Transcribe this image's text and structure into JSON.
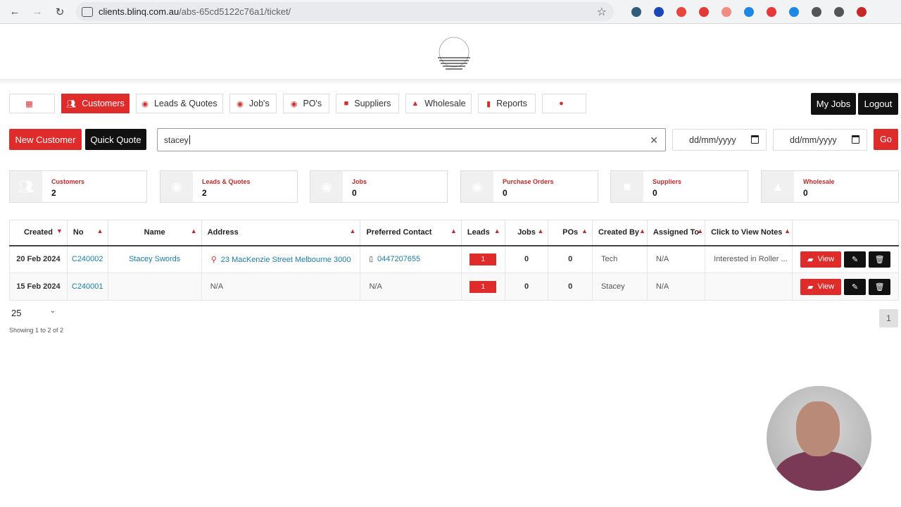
{
  "browser": {
    "url_host": "clients.blinq.com.au",
    "url_path": "/abs-65cd5122c76a1/ticket/",
    "extension_colors": [
      "#2f5d7c",
      "#1a47b8",
      "#e8453c",
      "#e53935",
      "#f28b82",
      "#1e88e5",
      "#e53935",
      "#1e88e5",
      "#555",
      "#555",
      "#c62828"
    ]
  },
  "nav": {
    "items": [
      {
        "icon": "calendar-icon",
        "label": ""
      },
      {
        "icon": "users-icon",
        "label": "Customers",
        "active": true
      },
      {
        "icon": "gauge-icon",
        "label": "Leads & Quotes"
      },
      {
        "icon": "gauge-icon",
        "label": "Job's"
      },
      {
        "icon": "gauge-icon",
        "label": "PO's"
      },
      {
        "icon": "truck-icon",
        "label": "Suppliers"
      },
      {
        "icon": "bag-icon",
        "label": "Wholesale"
      },
      {
        "icon": "chart-icon",
        "label": "Reports"
      },
      {
        "icon": "map-pin-icon",
        "label": ""
      }
    ],
    "my_jobs": "My Jobs",
    "logout": "Logout"
  },
  "actions": {
    "new_customer": "New Customer",
    "quick_quote": "Quick Quote",
    "search_value": "stacey",
    "date_from_placeholder": "dd/mm/yyyy",
    "date_to_placeholder": "dd/mm/yyyy",
    "go": "Go"
  },
  "cards": [
    {
      "label": "Customers",
      "count": "2",
      "icon": "users-icon"
    },
    {
      "label": "Leads & Quotes",
      "count": "2",
      "icon": "gauge-icon"
    },
    {
      "label": "Jobs",
      "count": "0",
      "icon": "gauge-icon"
    },
    {
      "label": "Purchase Orders",
      "count": "0",
      "icon": "gauge-icon"
    },
    {
      "label": "Suppliers",
      "count": "0",
      "icon": "truck-icon"
    },
    {
      "label": "Wholesale",
      "count": "0",
      "icon": "bag-icon"
    }
  ],
  "table": {
    "headers": [
      "Created",
      "No",
      "Name",
      "Address",
      "Preferred Contact",
      "Leads",
      "Jobs",
      "POs",
      "Created By",
      "Assigned To",
      "Click to View Notes",
      ""
    ],
    "rows": [
      {
        "created": "20 Feb 2024",
        "no": "C240002",
        "name": "Stacey Swords",
        "address": "23 MacKenzie Street Melbourne 3000",
        "contact": "0447207655",
        "leads": "1",
        "jobs": "0",
        "pos": "0",
        "created_by": "Tech",
        "assigned_to": "N/A",
        "notes": "Interested in Roller ...",
        "view": "View"
      },
      {
        "created": "15 Feb 2024",
        "no": "C240001",
        "name": "",
        "address": "N/A",
        "contact": "N/A",
        "leads": "1",
        "jobs": "0",
        "pos": "0",
        "created_by": "Stacey",
        "assigned_to": "N/A",
        "notes": "",
        "view": "View"
      }
    ]
  },
  "pagination": {
    "page_size": "25",
    "showing": "Showing 1 to 2 of 2",
    "current_page": "1"
  }
}
